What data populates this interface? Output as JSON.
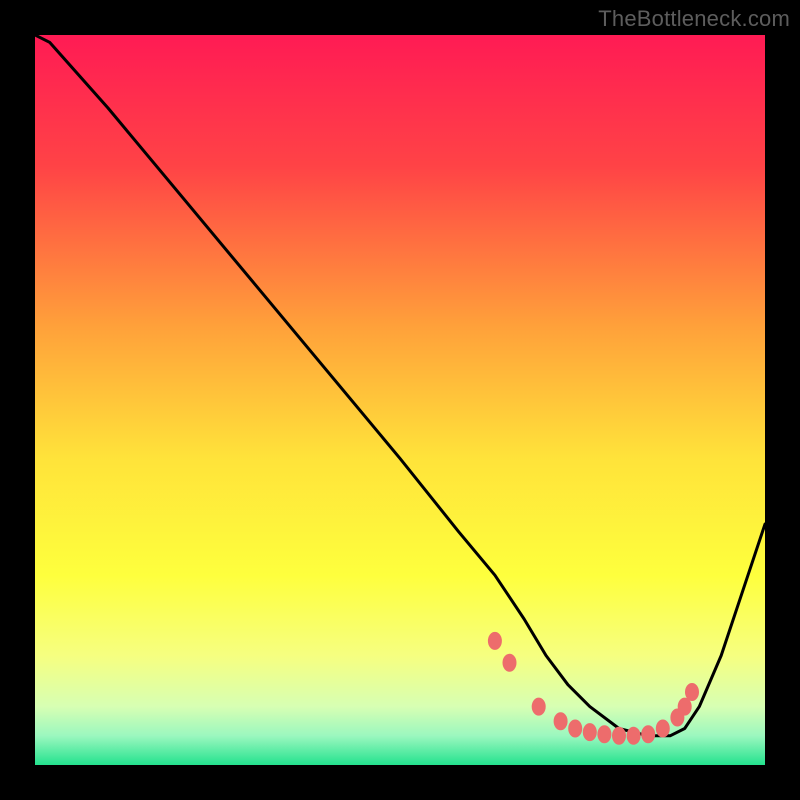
{
  "watermark": "TheBottleneck.com",
  "chart_data": {
    "type": "line",
    "title": "",
    "xlabel": "",
    "ylabel": "",
    "x_range_pct": [
      0,
      100
    ],
    "y_range_pct": [
      0,
      100
    ],
    "gradient_stops": [
      {
        "offset": 0,
        "color": "#ff1b54"
      },
      {
        "offset": 18,
        "color": "#ff4346"
      },
      {
        "offset": 40,
        "color": "#ffa13a"
      },
      {
        "offset": 58,
        "color": "#ffe33a"
      },
      {
        "offset": 74,
        "color": "#feff3d"
      },
      {
        "offset": 85,
        "color": "#f6ff80"
      },
      {
        "offset": 92,
        "color": "#d7ffb3"
      },
      {
        "offset": 96,
        "color": "#9bf7bf"
      },
      {
        "offset": 100,
        "color": "#24e28e"
      }
    ],
    "series": [
      {
        "name": "curve-x-pct",
        "values": [
          0,
          2,
          10,
          20,
          30,
          40,
          50,
          58,
          63,
          67,
          70,
          73,
          76,
          80,
          84,
          87,
          89,
          91,
          94,
          97,
          100
        ]
      },
      {
        "name": "curve-y-pct",
        "values": [
          100,
          99,
          90,
          78,
          66,
          54,
          42,
          32,
          26,
          20,
          15,
          11,
          8,
          5,
          4,
          4,
          5,
          8,
          15,
          24,
          33
        ]
      },
      {
        "name": "dots-x-pct",
        "values": [
          63,
          65,
          69,
          72,
          74,
          76,
          78,
          80,
          82,
          84,
          86,
          88,
          89,
          90
        ]
      },
      {
        "name": "dots-y-pct",
        "values": [
          17,
          14,
          8,
          6,
          5,
          4.5,
          4.2,
          4,
          4,
          4.2,
          5,
          6.5,
          8,
          10
        ]
      }
    ],
    "dot_color": "#ed6c6c",
    "curve_color": "#000000"
  }
}
